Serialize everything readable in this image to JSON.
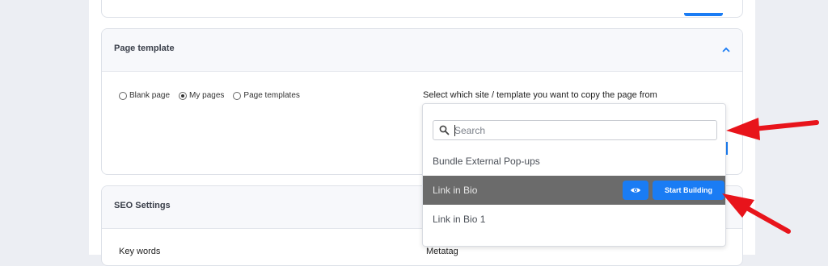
{
  "template_card": {
    "title": "Page template",
    "radios": [
      {
        "label": "Blank page",
        "checked": false
      },
      {
        "label": "My pages",
        "checked": true
      },
      {
        "label": "Page templates",
        "checked": false
      }
    ],
    "select_label": "Select which site / template you want to copy the page from"
  },
  "dropdown": {
    "search_placeholder": "Search",
    "options": [
      {
        "label": "Bundle External Pop-ups"
      },
      {
        "label": "Link in Bio",
        "highlighted": true,
        "preview_icon": "eye-icon",
        "action_label": "Start Building"
      },
      {
        "label": "Link in Bio 1"
      }
    ]
  },
  "seo_card": {
    "title": "SEO Settings",
    "keywords_label": "Key words",
    "metatag_label": "Metatag"
  },
  "colors": {
    "accent": "#1a7cf4",
    "highlight_row": "#6b6b6b",
    "annotation_arrow": "#e8141b"
  }
}
